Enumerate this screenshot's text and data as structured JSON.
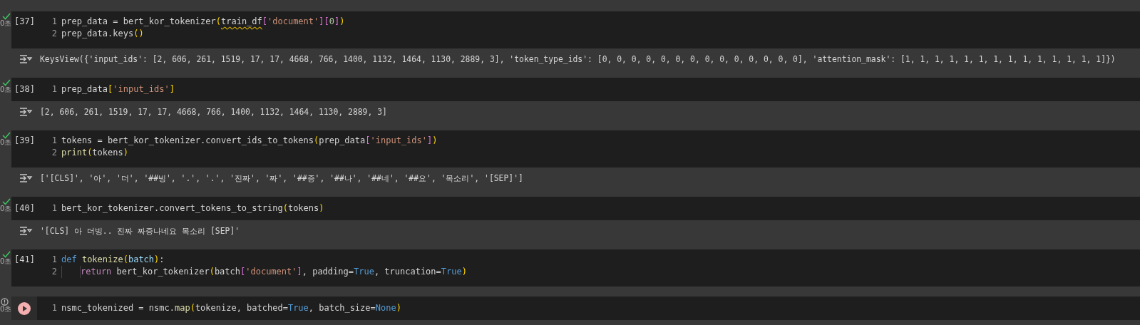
{
  "cells": [
    {
      "exec_count": "[37]",
      "kind": "done",
      "time": "0초",
      "lines": [
        {
          "number": "1",
          "indented": false,
          "tokens": [
            {
              "kind": "plain",
              "text": "prep_data = bert_kor_tokenizer"
            },
            {
              "kind": "paren",
              "text": "("
            },
            {
              "kind": "warning",
              "text": "train_df"
            },
            {
              "kind": "bracket",
              "text": "["
            },
            {
              "kind": "string",
              "text": "'document'"
            },
            {
              "kind": "bracket",
              "text": "]["
            },
            {
              "kind": "number",
              "text": "0"
            },
            {
              "kind": "bracket",
              "text": "]"
            },
            {
              "kind": "paren",
              "text": ")"
            }
          ]
        },
        {
          "number": "2",
          "indented": false,
          "tokens": [
            {
              "kind": "plain",
              "text": "prep_data.keys"
            },
            {
              "kind": "paren",
              "text": "()"
            }
          ]
        }
      ],
      "output": "KeysView({'input_ids': [2, 606, 261, 1519, 17, 17, 4668, 766, 1400, 1132, 1464, 1130, 2889, 3], 'token_type_ids': [0, 0, 0, 0, 0, 0, 0, 0, 0, 0, 0, 0, 0, 0], 'attention_mask': [1, 1, 1, 1, 1, 1, 1, 1, 1, 1, 1, 1, 1, 1]})"
    },
    {
      "exec_count": "[38]",
      "kind": "done",
      "time": "0초",
      "lines": [
        {
          "number": "1",
          "indented": false,
          "tokens": [
            {
              "kind": "plain",
              "text": "prep_data"
            },
            {
              "kind": "paren",
              "text": "["
            },
            {
              "kind": "string",
              "text": "'input_ids'"
            },
            {
              "kind": "paren",
              "text": "]"
            }
          ]
        }
      ],
      "output": "[2, 606, 261, 1519, 17, 17, 4668, 766, 1400, 1132, 1464, 1130, 2889, 3]"
    },
    {
      "exec_count": "[39]",
      "kind": "done",
      "time": "0초",
      "lines": [
        {
          "number": "1",
          "indented": false,
          "tokens": [
            {
              "kind": "plain",
              "text": "tokens = bert_kor_tokenizer.convert_ids_to_tokens"
            },
            {
              "kind": "paren",
              "text": "("
            },
            {
              "kind": "plain",
              "text": "prep_data"
            },
            {
              "kind": "bracket",
              "text": "["
            },
            {
              "kind": "string",
              "text": "'input_ids'"
            },
            {
              "kind": "bracket",
              "text": "]"
            },
            {
              "kind": "paren",
              "text": ")"
            }
          ]
        },
        {
          "number": "2",
          "indented": false,
          "tokens": [
            {
              "kind": "func",
              "text": "print"
            },
            {
              "kind": "paren",
              "text": "("
            },
            {
              "kind": "plain",
              "text": "tokens"
            },
            {
              "kind": "paren",
              "text": ")"
            }
          ]
        }
      ],
      "output": "['[CLS]', '아', '더', '##빙', '.', '.', '진짜', '짜', '##증', '##나', '##네', '##요', '목소리', '[SEP]']"
    },
    {
      "exec_count": "[40]",
      "kind": "done",
      "time": "0초",
      "lines": [
        {
          "number": "1",
          "indented": false,
          "tokens": [
            {
              "kind": "plain",
              "text": "bert_kor_tokenizer.convert_tokens_to_string"
            },
            {
              "kind": "paren",
              "text": "("
            },
            {
              "kind": "plain",
              "text": "tokens"
            },
            {
              "kind": "paren",
              "text": ")"
            }
          ]
        }
      ],
      "output": "'[CLS] 아 더빙.. 진짜 짜증나네요 목소리 [SEP]'"
    },
    {
      "exec_count": "[41]",
      "kind": "done",
      "time": "0초",
      "lines": [
        {
          "number": "1",
          "indented": false,
          "tokens": [
            {
              "kind": "keyword",
              "text": "def "
            },
            {
              "kind": "func",
              "text": "tokenize"
            },
            {
              "kind": "paren",
              "text": "("
            },
            {
              "kind": "param",
              "text": "batch"
            },
            {
              "kind": "paren",
              "text": ")"
            },
            {
              "kind": "plain",
              "text": ":"
            }
          ]
        },
        {
          "number": "2",
          "indented": true,
          "tokens": [
            {
              "kind": "control",
              "text": "return"
            },
            {
              "kind": "plain",
              "text": " bert_kor_tokenizer"
            },
            {
              "kind": "paren",
              "text": "("
            },
            {
              "kind": "plain",
              "text": "batch"
            },
            {
              "kind": "bracket",
              "text": "["
            },
            {
              "kind": "string",
              "text": "'document'"
            },
            {
              "kind": "bracket",
              "text": "]"
            },
            {
              "kind": "plain",
              "text": ", padding="
            },
            {
              "kind": "keyword",
              "text": "True"
            },
            {
              "kind": "plain",
              "text": ", truncation="
            },
            {
              "kind": "keyword",
              "text": "True"
            },
            {
              "kind": "paren",
              "text": ")"
            }
          ]
        }
      ]
    },
    {
      "kind": "error",
      "time": "0초",
      "lines": [
        {
          "number": "1",
          "indented": false,
          "tokens": [
            {
              "kind": "plain",
              "text": "nsmc_tokenized = nsmc."
            },
            {
              "kind": "func",
              "text": "map"
            },
            {
              "kind": "paren",
              "text": "("
            },
            {
              "kind": "plain",
              "text": "tokenize, batched="
            },
            {
              "kind": "keyword",
              "text": "True"
            },
            {
              "kind": "plain",
              "text": ", batch_size="
            },
            {
              "kind": "keyword",
              "text": "None"
            },
            {
              "kind": "paren",
              "text": ")"
            }
          ]
        }
      ]
    }
  ]
}
